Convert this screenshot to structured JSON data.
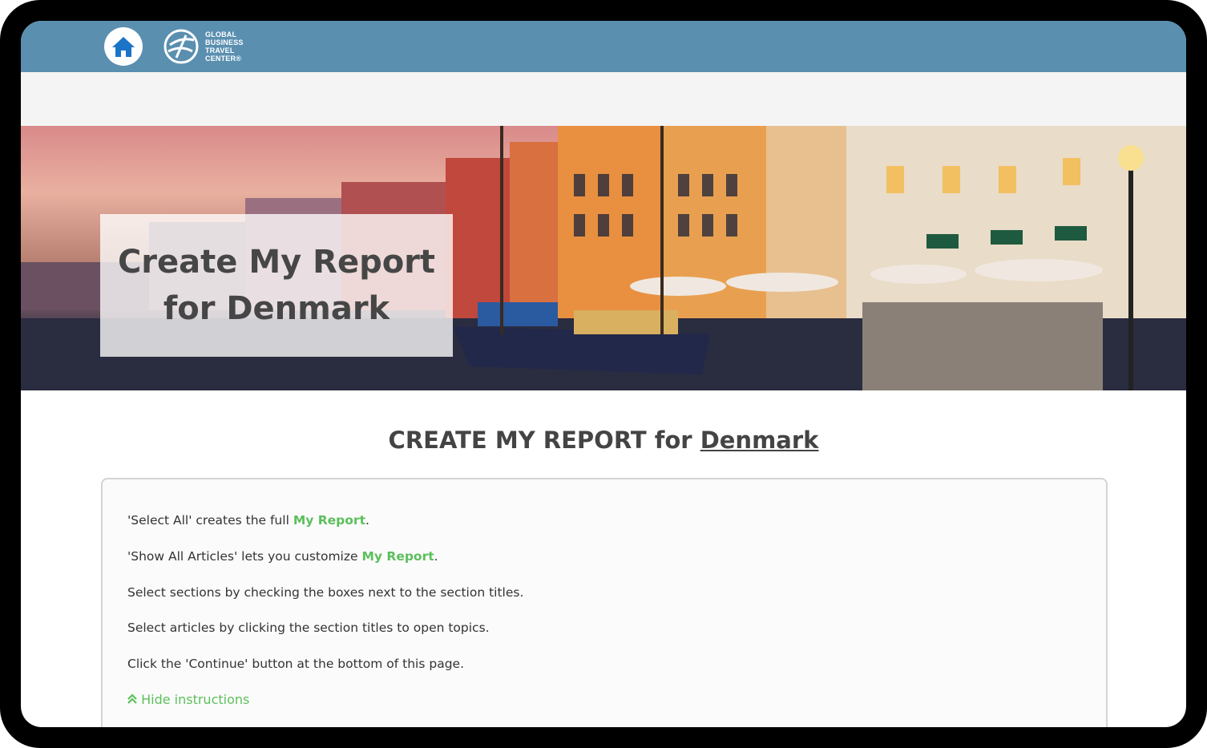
{
  "header": {
    "home_icon": "home-icon",
    "logo_lines": [
      "GLOBAL",
      "BUSINESS",
      "TRAVEL",
      "CENTER®"
    ]
  },
  "banner": {
    "title_line1": "Create My Report",
    "title_line2": "for Denmark"
  },
  "page": {
    "title_prefix": "CREATE MY REPORT for ",
    "country": "Denmark"
  },
  "instructions": {
    "line1_pre": "'Select All' creates the full ",
    "line1_link": "My Report",
    "line1_post": ".",
    "line2_pre": "'Show All Articles' lets you customize ",
    "line2_link": "My Report",
    "line2_post": ".",
    "line3": "Select sections by checking the boxes next to the section titles.",
    "line4": "Select articles by clicking the section titles to open topics.",
    "line5": "Click the 'Continue' button at the bottom of this page.",
    "hide_label": "Hide instructions",
    "hide_icon": "chevron-double-up-icon"
  },
  "colors": {
    "header_bg": "#5a8fb0",
    "accent_green": "#5cbf5c",
    "text_dark": "#444444"
  }
}
